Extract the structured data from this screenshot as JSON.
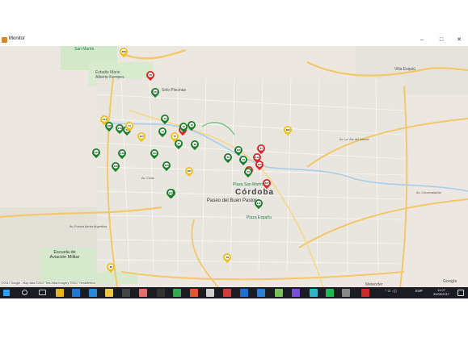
{
  "window": {
    "title": "Monitor",
    "minimize_glyph": "–",
    "maximize_glyph": "□",
    "close_glyph": "✕"
  },
  "map": {
    "city_label": "Córdoba",
    "labels": {
      "san_martin": "San Martín",
      "estadio": "Estadio Mario Alberto Kempes",
      "villa_esquiu": "Villa Esquiú",
      "paseo": "Paseo del Buen Pastor",
      "plaza_san_martin": "Plaza San Martín",
      "plaza_espana": "Plaza España",
      "escuela": "Escuela de Aviación Militar",
      "meteorfer": "Meteorfer",
      "pinares": "Solo Piscinas",
      "av_fuerza_aerea": "Av. Fuerza Aerea Argentina",
      "av_colon": "Av. Colón",
      "av_la_voz": "Av. La Voz del Interior",
      "av_circunvalacion": "Av. Circunvalación"
    },
    "copyright": "©2017 Google - Map data ©2017 Tele Atlas Imagery ©2017 TerraMetrics",
    "google_logo": "Google"
  },
  "markers": [
    {
      "label": "189",
      "color": "#f2c116"
    },
    {
      "label": "65",
      "color": "#e02424"
    },
    {
      "label": "121",
      "color": "#1a7f2a"
    },
    {
      "label": "13",
      "color": "#1a7f2a"
    },
    {
      "label": "7",
      "color": "#e02424"
    },
    {
      "label": "214",
      "color": "#f2c116"
    },
    {
      "label": "166",
      "color": "#1a7f2a"
    },
    {
      "label": "41",
      "color": "#1a7f2a"
    },
    {
      "label": "216",
      "color": "#1a7f2a"
    },
    {
      "label": "50",
      "color": "#1a7f2a"
    },
    {
      "label": "71",
      "color": "#f2c116"
    },
    {
      "label": "127",
      "color": "#f2c116"
    },
    {
      "label": "44",
      "color": "#1a7f2a"
    },
    {
      "label": "22",
      "color": "#1a7f2a"
    },
    {
      "label": "57",
      "color": "#f2c116"
    },
    {
      "label": "27",
      "color": "#1a7f2a"
    },
    {
      "label": "38",
      "color": "#1a7f2a"
    },
    {
      "label": "134",
      "color": "#1a7f2a"
    },
    {
      "label": "149",
      "color": "#1a7f2a"
    },
    {
      "label": "131",
      "color": "#1a7f2a"
    },
    {
      "label": "126",
      "color": "#1a7f2a"
    },
    {
      "label": "167",
      "color": "#f2c116"
    },
    {
      "label": "106",
      "color": "#1a7f2a"
    },
    {
      "label": "172",
      "color": "#1a7f2a"
    },
    {
      "label": "205",
      "color": "#f2c116"
    },
    {
      "label": "51",
      "color": "#e02424"
    },
    {
      "label": "135",
      "color": "#1a7f2a"
    },
    {
      "label": "82",
      "color": "#1a7f2a"
    },
    {
      "label": "70",
      "color": "#1a7f2a"
    },
    {
      "label": "112",
      "color": "#e02424"
    },
    {
      "label": "130",
      "color": "#e02424"
    },
    {
      "label": "12",
      "color": "#e02424"
    },
    {
      "label": "76",
      "color": "#1a7f2a"
    },
    {
      "label": "137",
      "color": "#e02424"
    },
    {
      "label": "111",
      "color": "#1a7f2a"
    },
    {
      "label": "122",
      "color": "#1a7f2a"
    },
    {
      "label": "16",
      "color": "#f2c116"
    },
    {
      "label": "69",
      "color": "#f2c116"
    }
  ],
  "taskbar": {
    "apps": [
      {
        "icon": "windows-start-icon",
        "color": "#2aa0ff"
      },
      {
        "icon": "search-icon",
        "color": "#cccccc"
      },
      {
        "icon": "task-view-icon",
        "color": "#cccccc"
      },
      {
        "icon": "chrome-icon",
        "color": "#e7b21d"
      },
      {
        "icon": "edge-icon",
        "color": "#1f7ad6"
      },
      {
        "icon": "store-icon",
        "color": "#2b8ad8"
      },
      {
        "icon": "explorer-icon",
        "color": "#f0c542"
      },
      {
        "icon": "calculator-icon",
        "color": "#444444"
      },
      {
        "icon": "paint-icon",
        "color": "#e07070"
      },
      {
        "icon": "terminal-icon",
        "color": "#333333"
      },
      {
        "icon": "maps-icon",
        "color": "#35a852"
      },
      {
        "icon": "office-icon",
        "color": "#e2572e"
      },
      {
        "icon": "app-icon-1",
        "color": "#cfcfcf"
      },
      {
        "icon": "app-icon-2",
        "color": "#d33b3b"
      },
      {
        "icon": "teamviewer-icon",
        "color": "#1c6fd0"
      },
      {
        "icon": "photos-icon",
        "color": "#2f7ed8"
      },
      {
        "icon": "android-icon",
        "color": "#78c257"
      },
      {
        "icon": "visual-studio-icon",
        "color": "#7a4fd8"
      },
      {
        "icon": "app-icon-3",
        "color": "#2fb4c8"
      },
      {
        "icon": "spotify-icon",
        "color": "#1db954"
      },
      {
        "icon": "app-icon-4",
        "color": "#888888"
      },
      {
        "icon": "monitor-app-icon",
        "color": "#cc2a2a"
      }
    ],
    "tray_lang": "ESP",
    "tray_time": "11:07",
    "tray_date": "30/05/2017"
  }
}
